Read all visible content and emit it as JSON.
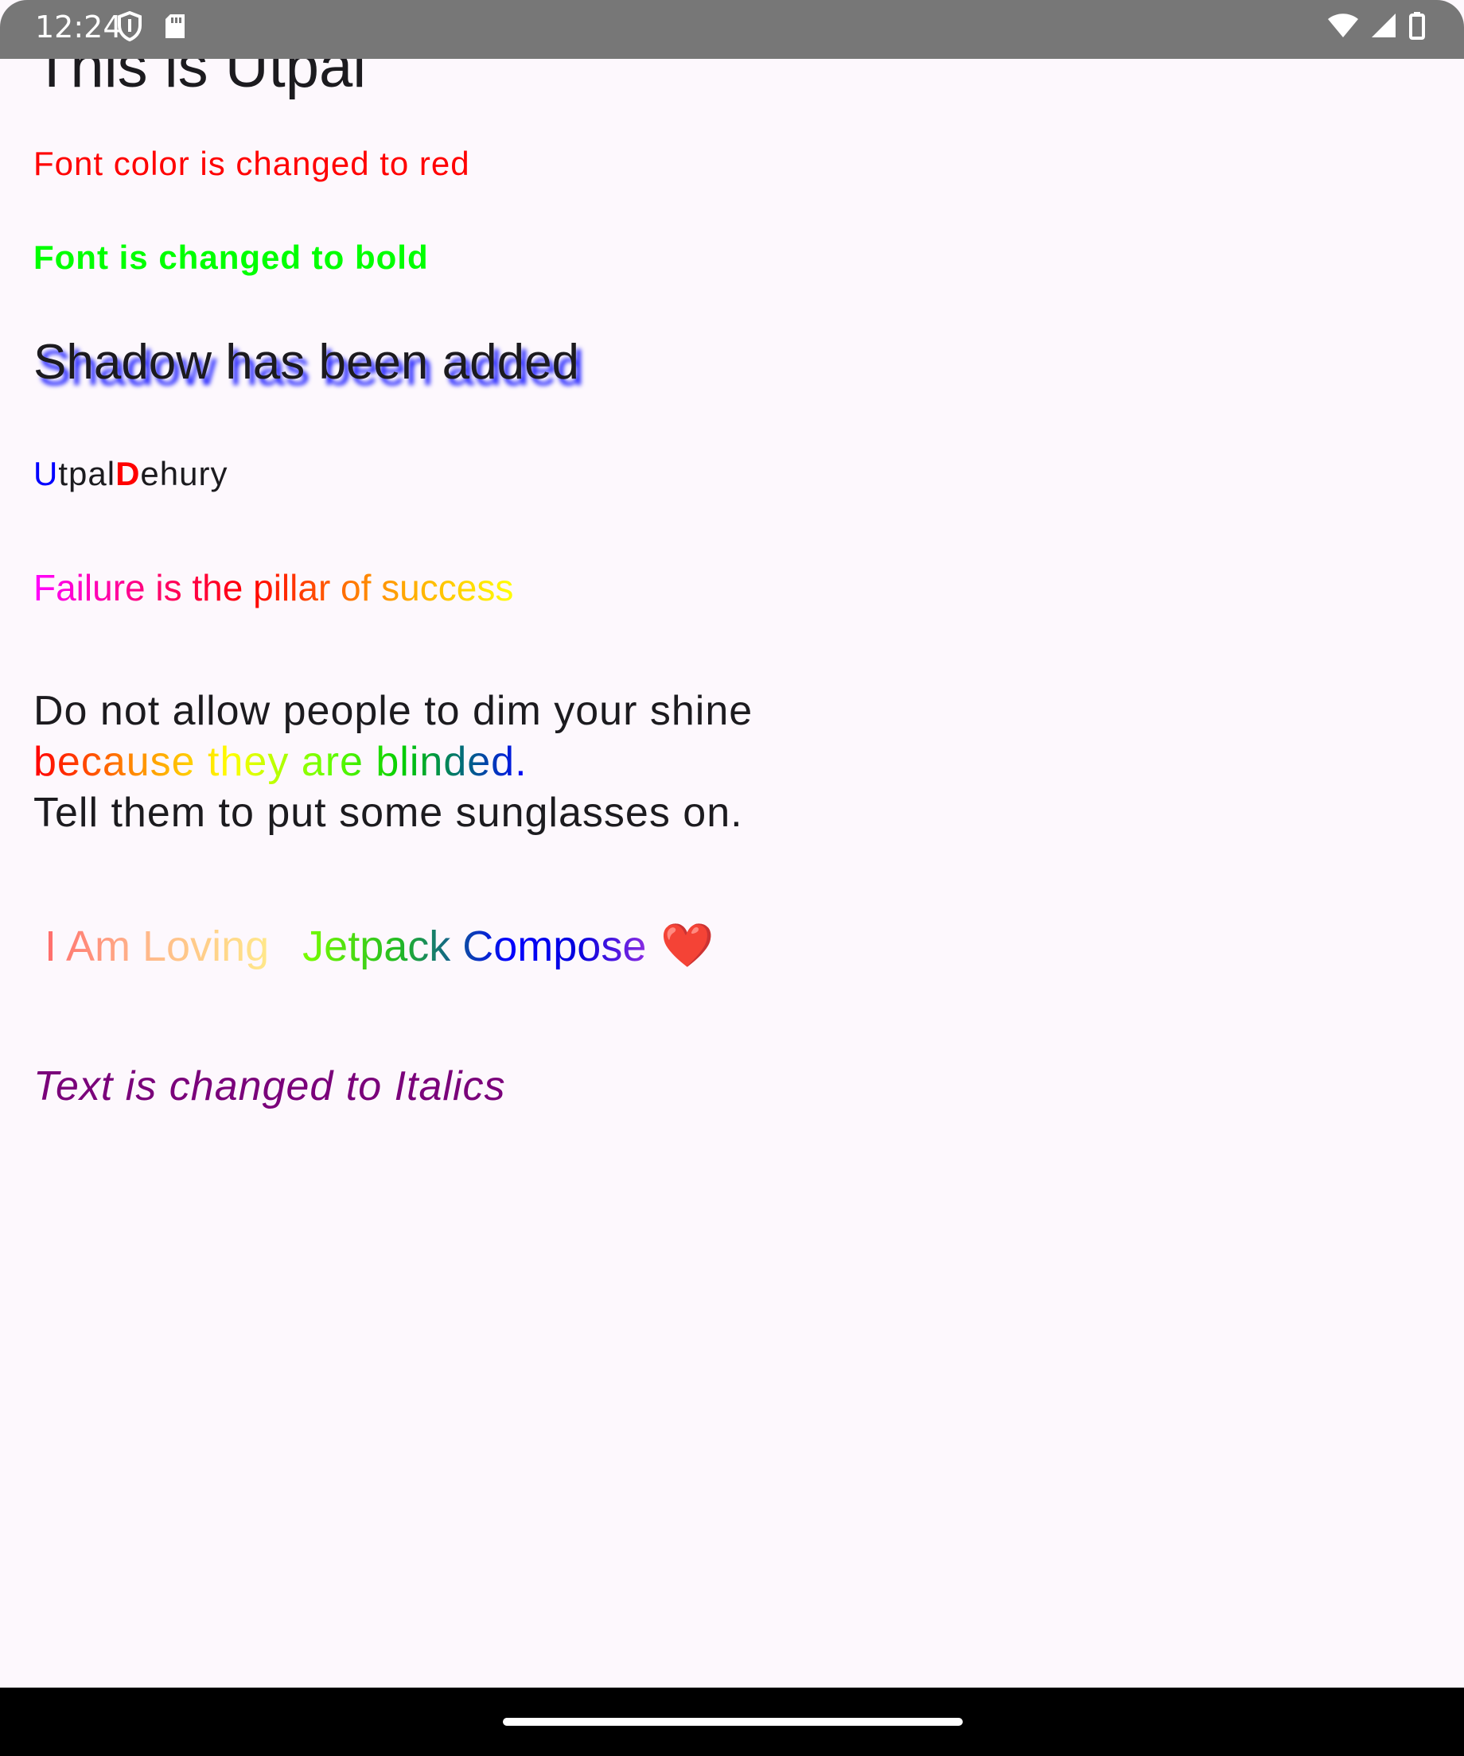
{
  "status_bar": {
    "time": "12:24",
    "icons_left": [
      "shield-icon",
      "sd-card-icon"
    ],
    "icons_right": [
      "wifi-icon",
      "cellular-signal-icon",
      "battery-icon"
    ]
  },
  "content": {
    "title": "This is Utpal",
    "red_text": "Font color is changed to red",
    "bold_text": "Font is changed to bold",
    "shadow_text": "Shadow has been added",
    "name": {
      "first_initial": "U",
      "first_rest": "tpal",
      "last_initial": "D",
      "last_rest": "ehury"
    },
    "gradient_text": "Failure is the pillar of success",
    "quote": {
      "line1": "Do not allow people to dim your shine",
      "line2": "because they are blinded.",
      "line3": "Tell them to put some sunglasses on."
    },
    "compose": {
      "part1": "I Am Loving",
      "part2": "Jetpack Compose",
      "emoji": "❤️"
    },
    "italic_text": "Text is changed to Italics"
  },
  "colors": {
    "background": "#fdf8fd",
    "status_bar": "#777777",
    "red": "#ff0000",
    "green": "#00ff00",
    "shadow": "#1a1aff",
    "blue": "#0000ff",
    "purple": "#7a007a"
  }
}
